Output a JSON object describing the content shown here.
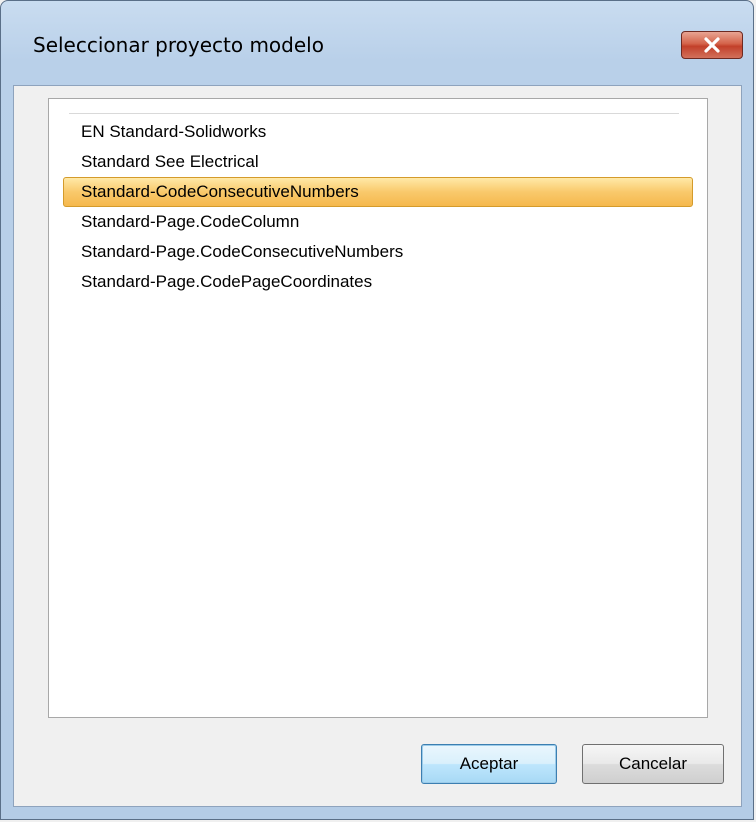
{
  "window": {
    "title": "Seleccionar proyecto modelo"
  },
  "list": {
    "items": [
      {
        "label": "EN Standard-Solidworks",
        "selected": false
      },
      {
        "label": "Standard See Electrical",
        "selected": false
      },
      {
        "label": "Standard-CodeConsecutiveNumbers",
        "selected": true
      },
      {
        "label": "Standard-Page.CodeColumn",
        "selected": false
      },
      {
        "label": "Standard-Page.CodeConsecutiveNumbers",
        "selected": false
      },
      {
        "label": "Standard-Page.CodePageCoordinates",
        "selected": false
      }
    ]
  },
  "buttons": {
    "ok_label": "Aceptar",
    "cancel_label": "Cancelar"
  },
  "colors": {
    "selection": "#f9c96b",
    "close_button": "#c2402a"
  }
}
